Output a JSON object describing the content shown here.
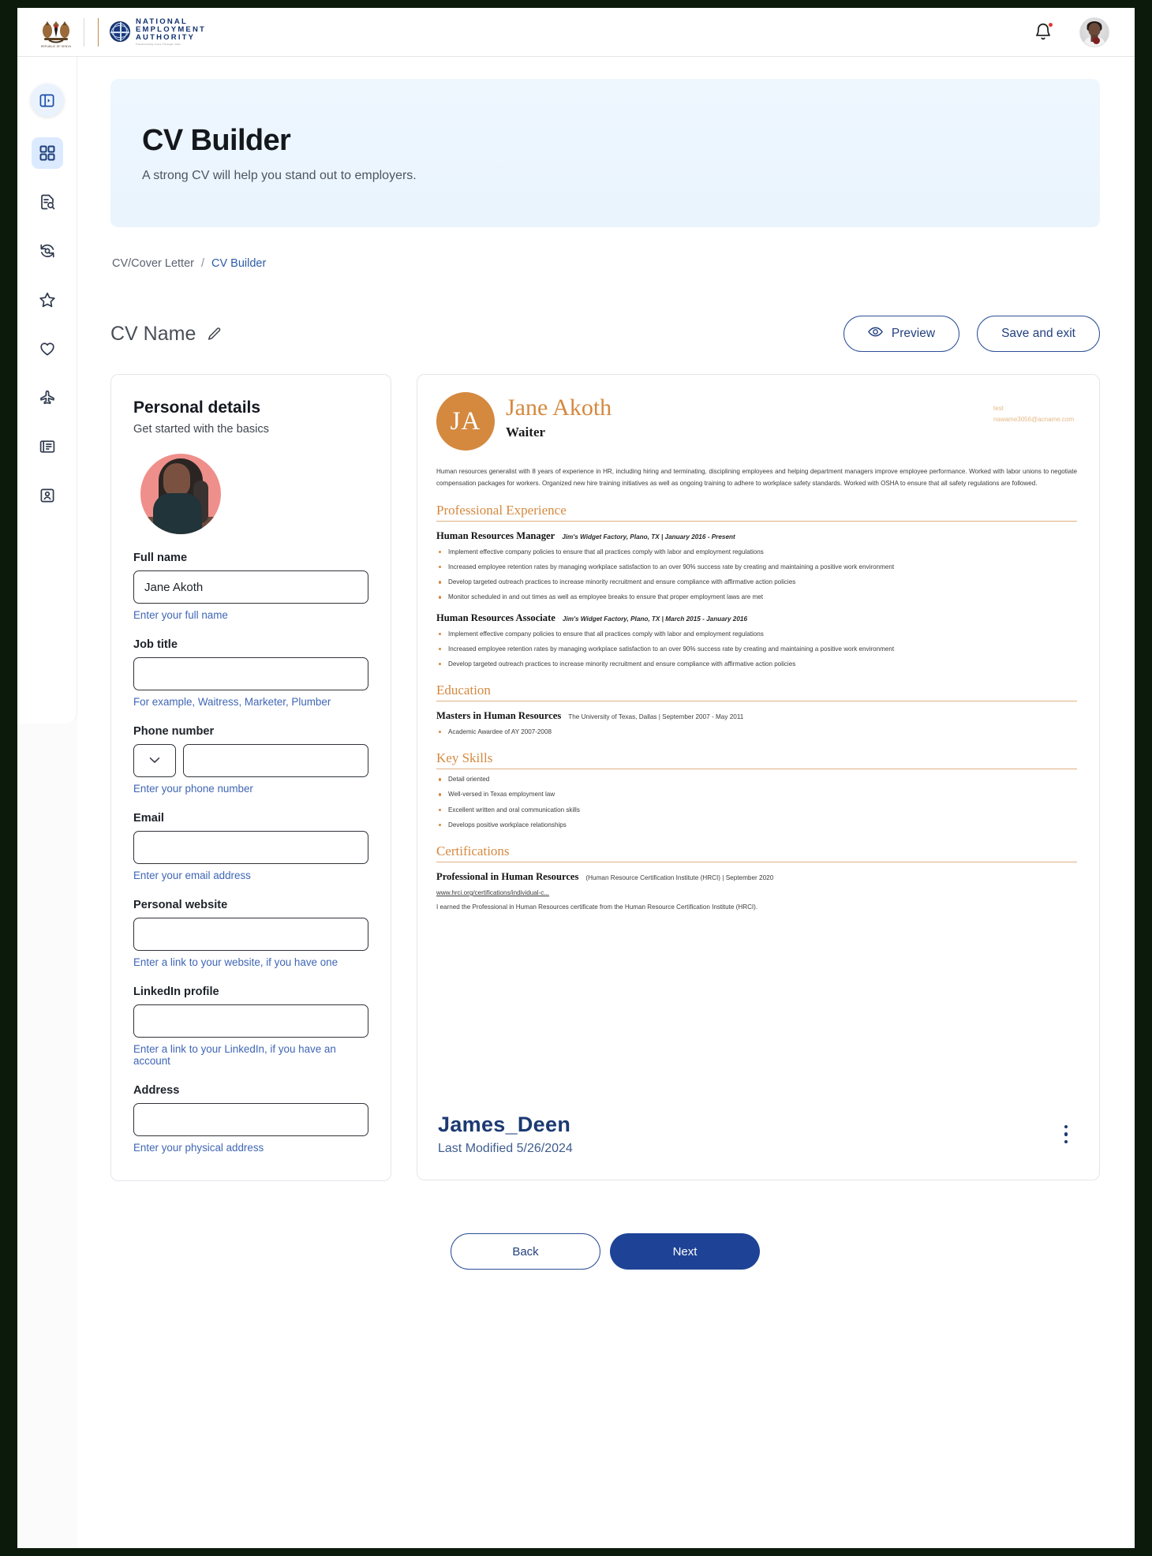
{
  "topbar": {
    "coat_caption": "REPUBLIC OF KENYA",
    "org_line1": "NATIONAL",
    "org_line2": "EMPLOYMENT",
    "org_line3": "AUTHORITY",
    "org_tagline": "Transforming Lives Through Jobs",
    "bell_icon": "notification-bell-icon",
    "avatar_icon": "user-avatar"
  },
  "sidebar": {
    "items": [
      {
        "icon": "panel-collapse-icon",
        "name": "collapse-panel"
      },
      {
        "icon": "dashboard-grid-icon",
        "name": "dashboard"
      },
      {
        "icon": "document-search-icon",
        "name": "job-search"
      },
      {
        "icon": "history-refresh-icon",
        "name": "history"
      },
      {
        "icon": "star-icon",
        "name": "favorites"
      },
      {
        "icon": "heart-icon",
        "name": "saved"
      },
      {
        "icon": "airplane-icon",
        "name": "travel"
      },
      {
        "icon": "news-building-icon",
        "name": "news"
      },
      {
        "icon": "id-card-icon",
        "name": "profile"
      }
    ]
  },
  "hero": {
    "title": "CV Builder",
    "subtitle": "A strong CV will help you stand out to employers."
  },
  "breadcrumb": {
    "parent": "CV/Cover Letter",
    "separator": "/",
    "current": "CV Builder"
  },
  "title_row": {
    "cv_name_label": "CV Name",
    "edit_icon": "pencil-edit-icon",
    "preview_label": "Preview",
    "preview_icon": "eye-icon",
    "save_exit_label": "Save and exit"
  },
  "form": {
    "heading": "Personal details",
    "subheading": "Get started with the basics",
    "photo_alt": "profile-photo",
    "fields": [
      {
        "label": "Full name",
        "value": "Jane Akoth",
        "placeholder": "",
        "hint": "Enter your full name",
        "name": "full-name"
      },
      {
        "label": "Job title",
        "value": "",
        "placeholder": "",
        "hint": "For example, Waitress, Marketer, Plumber",
        "name": "job-title"
      },
      {
        "label": "Phone number",
        "value": "",
        "placeholder": "",
        "hint": "Enter your phone number",
        "name": "phone-number",
        "country_code": ""
      },
      {
        "label": "Email",
        "value": "",
        "placeholder": "",
        "hint": "Enter your email address",
        "name": "email"
      },
      {
        "label": "Personal website",
        "value": "",
        "placeholder": "",
        "hint": "Enter a link to your website, if you have one",
        "name": "personal-website"
      },
      {
        "label": "LinkedIn profile",
        "value": "",
        "placeholder": "",
        "hint": "Enter a link to your LinkedIn, if you have an account",
        "name": "linkedin-profile"
      },
      {
        "label": "Address",
        "value": "",
        "placeholder": "",
        "hint": "Enter your physical address",
        "name": "address"
      }
    ]
  },
  "cv_preview": {
    "monogram": "JA",
    "name": "Jane Akoth",
    "role": "Waiter",
    "contact_line1": "test",
    "contact_line2": "nawame3056@acname.com",
    "summary": "Human resources generalist with 8 years of experience in HR, including hiring and terminating, disciplining employees and helping department managers improve employee performance. Worked with labor unions to negotiate compensation packages for workers. Organized new hire training initiatives as well as ongoing training to adhere to workplace safety standards. Worked with OSHA to ensure that all safety regulations are followed.",
    "sections": [
      {
        "heading": "Professional Experience",
        "entries": [
          {
            "title": "Human Resources Manager",
            "meta": "Jim's Widget Factory, Plano, TX | January 2016 - Present",
            "meta_italic": true,
            "bullets": [
              "Implement effective company policies to ensure that all practices comply with labor and employment regulations",
              "Increased employee retention rates by managing workplace satisfaction to an over 90% success rate by creating and maintaining a positive work environment",
              "Develop targeted outreach practices to increase minority recruitment and ensure compliance with affirmative action policies",
              "Monitor scheduled in and out times as well as employee breaks to ensure that proper employment laws are met"
            ]
          },
          {
            "title": "Human Resources Associate",
            "meta": "Jim's Widget Factory, Plano, TX | March 2015 - January 2016",
            "meta_italic": true,
            "bullets": [
              "Implement effective company policies to ensure that all practices comply with labor and employment regulations",
              "Increased employee retention rates by managing workplace satisfaction to an over 90% success rate by creating and maintaining a positive work environment",
              "Develop targeted outreach practices to increase minority recruitment and ensure compliance with affirmative action policies"
            ]
          }
        ]
      },
      {
        "heading": "Education",
        "entries": [
          {
            "title": "Masters in Human Resources",
            "meta": "The University of Texas, Dallas | September 2007 - May 2011",
            "meta_italic": false,
            "bullets": [
              "Academic Awardee of AY 2007-2008"
            ]
          }
        ]
      },
      {
        "heading": "Key Skills",
        "entries": [
          {
            "title": "",
            "meta": "",
            "meta_italic": false,
            "bullets": [
              "Detail oriented",
              "Well-versed in Texas employment law",
              "Excellent written and oral communication skills",
              "Develops positive workplace relationships"
            ]
          }
        ]
      },
      {
        "heading": "Certifications",
        "entries": [
          {
            "title": "Professional in Human Resources",
            "meta": "(Human Resource Certification Institute (HRCI) | September 2020",
            "meta_italic": false,
            "bullets": [],
            "link": "www.hrci.org/certifications/individual-c...",
            "note": "I earned the Professional in Human Resources certificate from the Human Resource Certification Institute (HRCI)."
          }
        ]
      }
    ],
    "doc_title": "James_Deen",
    "doc_modified": "Last Modified 5/26/2024",
    "kebab_icon": "more-options-icon"
  },
  "footer": {
    "back_label": "Back",
    "next_label": "Next"
  },
  "colors": {
    "accent_blue": "#1e4396",
    "hero_bg": "#eaf4fd",
    "cv_accent": "#d4893f",
    "hint_blue": "#3f66b5"
  }
}
